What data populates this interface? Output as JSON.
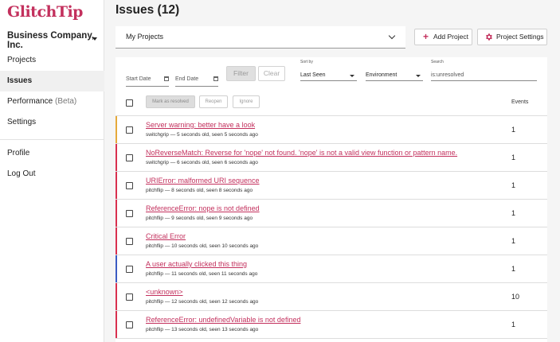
{
  "app": {
    "logo": "GlitchTip",
    "organization": "Business Company, Inc."
  },
  "nav": {
    "projects": "Projects",
    "issues": "Issues",
    "performance": "Performance",
    "performance_badge": "(Beta)",
    "settings": "Settings",
    "profile": "Profile",
    "logout": "Log Out"
  },
  "header": {
    "title": "Issues (12)",
    "project_select": "My Projects",
    "add_project": "Add Project",
    "project_settings": "Project Settings"
  },
  "filters": {
    "start_date_placeholder": "Start Date",
    "end_date_placeholder": "End Date",
    "filter_button": "Filter",
    "clear_button": "Clear",
    "sort_label": "Sort by",
    "sort_value": "Last Seen",
    "environment_value": "Environment",
    "search_label": "Search",
    "search_value": "is:unresolved"
  },
  "bulk": {
    "mark_resolved": "Mark as resolved",
    "reopen": "Reopen",
    "ignore": "Ignore",
    "events_header": "Events"
  },
  "colors": {
    "accent": "#c3305d",
    "level_warning": "#e5a93a",
    "level_error": "#d9304f",
    "level_info": "#3b5bc2"
  },
  "issues": [
    {
      "title": "Server warning: better have a look",
      "meta": "switchgrip — 5 seconds old, seen 5 seconds ago",
      "count": "1",
      "level_color": "#e5a93a"
    },
    {
      "title": "NoReverseMatch: Reverse for 'nope' not found. 'nope' is not a valid view function or pattern name.",
      "meta": "switchgrip — 6 seconds old, seen 6 seconds ago",
      "count": "1",
      "level_color": "#d9304f"
    },
    {
      "title": "URIError: malformed URI sequence",
      "meta": "pitchflip — 8 seconds old, seen 8 seconds ago",
      "count": "1",
      "level_color": "#d9304f"
    },
    {
      "title": "ReferenceError: nope is not defined",
      "meta": "pitchflip — 9 seconds old, seen 9 seconds ago",
      "count": "1",
      "level_color": "#d9304f"
    },
    {
      "title": "Critical Error",
      "meta": "pitchflip — 10 seconds old, seen 10 seconds ago",
      "count": "1",
      "level_color": "#d9304f"
    },
    {
      "title": "A user actually clicked this thing",
      "meta": "pitchflip — 11 seconds old, seen 11 seconds ago",
      "count": "1",
      "level_color": "#3b5bc2"
    },
    {
      "title": "<unknown>",
      "meta": "pitchflip — 12 seconds old, seen 12 seconds ago",
      "count": "10",
      "level_color": "#d9304f"
    },
    {
      "title": "ReferenceError: undefinedVariable is not defined",
      "meta": "pitchflip — 13 seconds old, seen 13 seconds ago",
      "count": "1",
      "level_color": "#d9304f"
    }
  ]
}
